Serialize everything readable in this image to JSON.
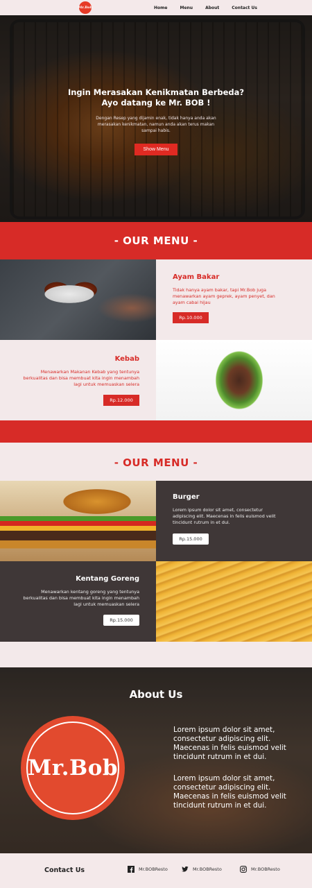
{
  "nav": {
    "logo_text": "Mr.Bob",
    "links": [
      "Home",
      "Menu",
      "About",
      "Contact Us"
    ]
  },
  "hero": {
    "title_line1": "Ingin Merasakan Kenikmatan Berbeda?",
    "title_line2": "Ayo datang ke Mr. BOB !",
    "description": "Dengan Resep yang dijamin enak, tidak hanya anda akan merasakan kenikmatan, namun anda akan terus makan sampai habis.",
    "button": "Show Menu"
  },
  "menu1": {
    "title": "- OUR MENU -",
    "items": [
      {
        "name": "Ayam Bakar",
        "description": "Tidak hanya ayam bakar, tapi Mr.Bob juga menawarkan ayam geprek, ayam penyet, dan ayam cabai hijau",
        "price": "Rp.10.000"
      },
      {
        "name": "Kebab",
        "description": "Menawarkan Makanan Kebab yang tentunya berkualitas dan bisa membuat kita ingin menambah lagi untuk memuaskan selera",
        "price": "Rp.12.000"
      }
    ]
  },
  "menu2": {
    "title": "- OUR MENU -",
    "items": [
      {
        "name": "Burger",
        "description": "Lorem ipsum dolor sit amet, consectetur adipiscing elit. Maecenas in felis euismod velit tincidunt rutrum in et dui.",
        "price": "Rp.15.000"
      },
      {
        "name": "Kentang Goreng",
        "description": "Menawarkan kentang goreng yang tentunya berkualitas dan bisa membuat kita ingin menambah lagi untuk memuaskan selera",
        "price": "Rp.15.000"
      }
    ]
  },
  "about": {
    "title": "About Us",
    "logo_text": "Mr.Bob",
    "paragraphs": [
      "Lorem ipsum dolor sit amet, consectetur adipiscing elit. Maecenas in felis euismod velit tincidunt rutrum in et dui.",
      "Lorem ipsum dolor sit amet, consectetur adipiscing elit. Maecenas in felis euismod velit tincidunt rutrum in et dui."
    ]
  },
  "footer": {
    "title": "Contact Us",
    "socials": [
      {
        "icon": "facebook-icon",
        "handle": "Mr.BOBResto"
      },
      {
        "icon": "twitter-icon",
        "handle": "Mr.BOBResto"
      },
      {
        "icon": "instagram-icon",
        "handle": "Mr.BOBResto"
      }
    ]
  },
  "colors": {
    "brand_red": "#d72b27",
    "button_red": "#e02a22",
    "light_bg": "#f3e9ea",
    "dark_tile": "#3f3737"
  }
}
